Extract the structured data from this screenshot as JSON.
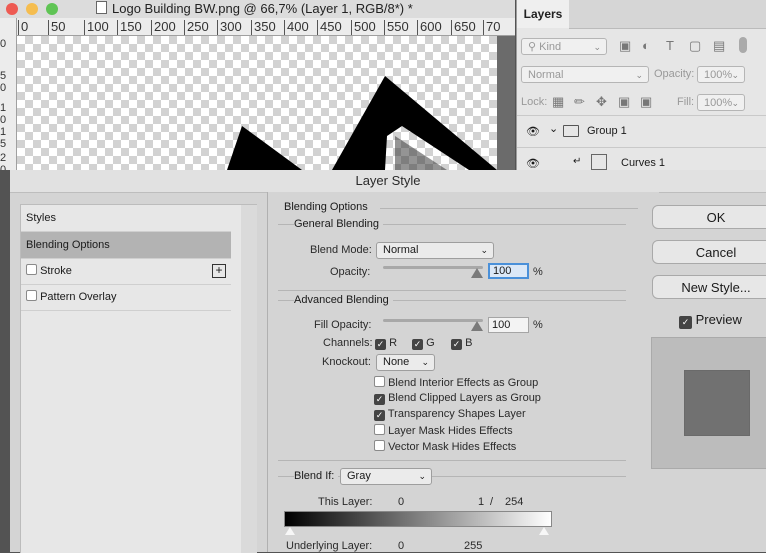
{
  "document": {
    "title": "Logo Building BW.png @ 66,7% (Layer 1, RGB/8*) *",
    "ruler_top": [
      "0",
      "50",
      "100",
      "150",
      "200",
      "250",
      "300",
      "350",
      "400",
      "450",
      "500",
      "550",
      "600",
      "650",
      "70"
    ],
    "ruler_left": [
      "0",
      "5",
      "0",
      "1",
      "0",
      "1",
      "5",
      "2",
      "0"
    ],
    "traffic_colors": [
      "#ee5a52",
      "#f5bd4f",
      "#5fc454"
    ]
  },
  "layers_panel": {
    "tab": "Layers",
    "kind_filter": "Kind",
    "blend_mode": "Normal",
    "opacity_label": "Opacity:",
    "opacity_value": "100%",
    "lock_label": "Lock:",
    "fill_label": "Fill:",
    "fill_value": "100%",
    "layers": [
      {
        "name": "Group 1"
      },
      {
        "name": "Curves 1"
      }
    ]
  },
  "dialog": {
    "title": "Layer Style",
    "styles_list": {
      "header": "Styles",
      "items": [
        {
          "label": "Blending Options",
          "selected": true
        },
        {
          "label": "Stroke",
          "checked": false
        },
        {
          "label": "Pattern Overlay",
          "checked": false
        }
      ]
    },
    "blending": {
      "section_title": "Blending Options",
      "general": {
        "title": "General Blending",
        "blend_mode_label": "Blend Mode:",
        "blend_mode_value": "Normal",
        "opacity_label": "Opacity:",
        "opacity_value": "100",
        "percent": "%"
      },
      "advanced": {
        "title": "Advanced Blending",
        "fill_opacity_label": "Fill Opacity:",
        "fill_opacity_value": "100",
        "percent": "%",
        "channels_label": "Channels:",
        "channels": [
          {
            "label": "R",
            "checked": true
          },
          {
            "label": "G",
            "checked": true
          },
          {
            "label": "B",
            "checked": true
          }
        ],
        "knockout_label": "Knockout:",
        "knockout_value": "None",
        "options": [
          {
            "label": "Blend Interior Effects as Group",
            "checked": false
          },
          {
            "label": "Blend Clipped Layers as Group",
            "checked": true
          },
          {
            "label": "Transparency Shapes Layer",
            "checked": true
          },
          {
            "label": "Layer Mask Hides Effects",
            "checked": false
          },
          {
            "label": "Vector Mask Hides Effects",
            "checked": false
          }
        ]
      },
      "blend_if": {
        "label": "Blend If:",
        "value": "Gray",
        "this_layer_label": "This Layer:",
        "this_layer_low": "0",
        "this_layer_high_a": "1",
        "this_layer_sep": "/",
        "this_layer_high_b": "254",
        "underlying_label": "Underlying Layer:",
        "underlying_low": "0",
        "underlying_high": "255"
      }
    },
    "buttons": {
      "ok": "OK",
      "cancel": "Cancel",
      "new_style": "New Style...",
      "preview_label": "Preview",
      "preview_checked": true
    }
  }
}
